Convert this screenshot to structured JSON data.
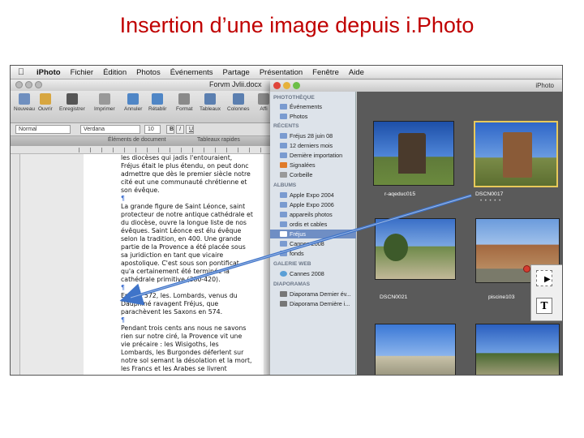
{
  "slide_title": "Insertion d’une image depuis i.Photo",
  "menubar": {
    "app": "iPhoto",
    "items": [
      "Fichier",
      "Édition",
      "Photos",
      "Événements",
      "Partage",
      "Présentation",
      "Fenêtre",
      "Aide"
    ],
    "right_app": "iPhoto"
  },
  "word": {
    "document_title": "Forvm Jvlii.docx",
    "toolbar_labels": [
      "Nouveau",
      "Ouvrir",
      "Enregistrer",
      "Imprimer",
      "Annuler",
      "Rétablir",
      "Format",
      "Tableaux",
      "Colonnes",
      "Affi"
    ],
    "style_field": "Normal",
    "font_field": "Verdana",
    "size_field": "10",
    "ribbon_tabs": [
      "Éléments de document",
      "Tableaux rapides"
    ],
    "paragraphs": [
      "les diocèses qui jadis l'entouraient,\nFréjus était le plus étendu, on peut donc\nadmettre que dès le premier siècle notre\ncité eut une communauté chrétienne et\nson évêque.",
      "",
      "La grande figure de Saint Léonce, saint\nprotecteur de notre antique cathédrale et\ndu diocèse, ouvre la longue liste de nos\névêques. Saint Léonce est élu évêque\nselon la tradition, en 400. Une grande\npartie de la Provence a été placée sous\nsa juridiction en tant que vicaire\napostolique. C'est sous son pontificat\nqu'a certainement été terminée la\ncathédrale primitive (380-420).",
      "",
      "En l'an 572, les. Lombards, venus du\nDauphiné ravagent Fréjus, que\nparachèvent les Saxons en 574.",
      "Pendant trois cents ans nous ne savons\nrien sur notre ciré, la Provence vit une\nvie précaire : les Wisigoths, les\nLombards, les Burgondes déferlent sur\nnotre sol semant la désolation et la mort,\nles Francs et les Arabes se livrent"
    ]
  },
  "iphoto_browser": {
    "title": "iPhoto",
    "sidebar": {
      "sections": [
        {
          "header": "PHOTOTHÈQUE",
          "items": [
            "Événements",
            "Photos"
          ]
        },
        {
          "header": "RÉCENTS",
          "items": [
            "Fréjus 28 juin 08",
            "12 derniers mois",
            "Dernière importation",
            "Signalées",
            "Corbeille"
          ]
        },
        {
          "header": "ALBUMS",
          "items": [
            "Apple Expo 2004",
            "Apple Expo 2006",
            "appareils photos",
            "ordis et cables",
            "Fréjus",
            "Cannes 2008",
            "fonds"
          ]
        },
        {
          "header": "GALERIE WEB",
          "items": [
            "Cannes 2008"
          ]
        },
        {
          "header": "DIAPORAMAS",
          "items": [
            "Diaporama Dernier év...",
            "Diaporama Dernière i..."
          ]
        }
      ],
      "selected_item": "Fréjus"
    },
    "photos": [
      {
        "caption": "r-aqeduc015",
        "selected": false
      },
      {
        "caption": "DSCN0017",
        "selected": true,
        "stars": "• • • • •"
      },
      {
        "caption": "DSCN0021",
        "selected": false
      },
      {
        "caption": "piscine103",
        "selected": false
      },
      {
        "caption": "",
        "selected": false
      },
      {
        "caption": "",
        "selected": false
      }
    ]
  },
  "palette": {
    "tools": [
      "selection-tool",
      "text-box-tool"
    ],
    "text_tool_glyph": "T"
  },
  "colors": {
    "title": "#c00000",
    "arrow": "#3f74c9",
    "selection_outline": "#e8c95a",
    "sidebar_selected": "#6f8ec4"
  }
}
